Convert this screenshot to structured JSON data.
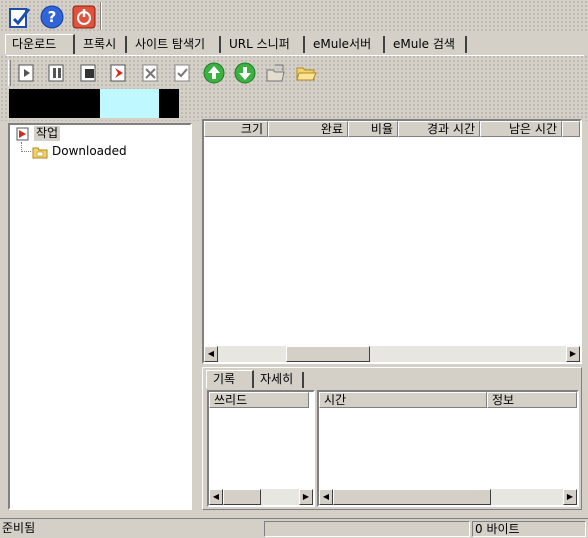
{
  "toolbar_top": {
    "icons": [
      "edit-icon",
      "help-icon",
      "power-icon"
    ]
  },
  "tabs": [
    "다운로드",
    "프록시",
    "사이트 탐색기",
    "URL 스니퍼",
    "eMule서버",
    "eMule 검색"
  ],
  "action_toolbar": {
    "icons": [
      "start-icon",
      "pause-icon",
      "stop-icon",
      "schedule-icon",
      "delete-icon",
      "properties-icon",
      "move-up-icon",
      "move-down-icon",
      "open-file-icon",
      "open-folder-icon"
    ]
  },
  "colors": {
    "progress_black": "#000000",
    "progress_cyan": "#bff8ff",
    "window_bg": "#d4d0c8"
  },
  "tree": {
    "root_label": "작업",
    "child_label": "Downloaded"
  },
  "download_list": {
    "columns": [
      "크기",
      "완료",
      "비율",
      "경과 시간",
      "남은 시간"
    ]
  },
  "log_panel": {
    "tabs": [
      "기록",
      "자세히"
    ],
    "thread_column": "쓰리드",
    "columns": [
      "시간",
      "정보"
    ]
  },
  "status_bar": {
    "status": "준비됨",
    "bytes": "0 바이트"
  }
}
